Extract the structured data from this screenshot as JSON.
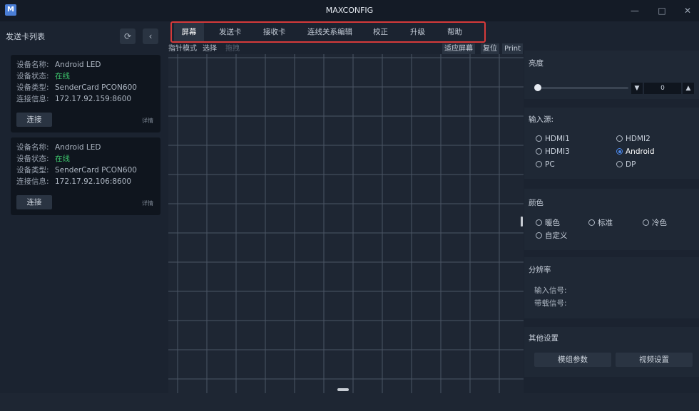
{
  "window": {
    "logo": "M",
    "title": "MAXCONFIG",
    "minimize": "—",
    "maximize": "□",
    "close": "✕"
  },
  "sidebar": {
    "title": "发送卡列表",
    "refresh_icon": "refresh-icon",
    "collapse_icon": "chevron-left-icon",
    "cards": [
      {
        "name_label": "设备名称:",
        "name": "Android LED",
        "status_label": "设备状态:",
        "status": "在线",
        "type_label": "设备类型:",
        "type": "SenderCard PCON600",
        "conn_label": "连接信息:",
        "conn": "172.17.92.159:8600",
        "connect": "连接",
        "detail": "详情"
      },
      {
        "name_label": "设备名称:",
        "name": "Android LED",
        "status_label": "设备状态:",
        "status": "在线",
        "type_label": "设备类型:",
        "type": "SenderCard PCON600",
        "conn_label": "连接信息:",
        "conn": "172.17.92.106:8600",
        "connect": "连接",
        "detail": "详情"
      }
    ]
  },
  "menu": {
    "items": [
      "屏幕",
      "发送卡",
      "接收卡",
      "连线关系编辑",
      "校正",
      "升级",
      "帮助"
    ],
    "active": "屏幕"
  },
  "toolbar": {
    "pointer_mode": "指针模式",
    "select": "选择",
    "drag": "拖拽",
    "fit_screen": "适应屏幕",
    "reset": "复位",
    "print": "Print"
  },
  "right_panel": {
    "brightness": {
      "title": "亮度",
      "value": "0",
      "level": 0
    },
    "input_source": {
      "title": "输入源:",
      "options": [
        "HDMI1",
        "HDMI2",
        "HDMI3",
        "Android",
        "PC",
        "DP"
      ],
      "selected": "Android"
    },
    "color": {
      "title": "颜色",
      "options": [
        "暖色",
        "标准",
        "冷色",
        "自定义"
      ]
    },
    "resolution": {
      "title": "分辨率",
      "input_signal": "输入信号:",
      "carrier_signal": "带载信号:"
    },
    "other": {
      "title": "其他设置",
      "module_params": "模组参数",
      "video_settings": "视频设置"
    }
  },
  "colors": {
    "accent": "#4a86e8",
    "online": "#3cc26b",
    "highlight_border": "#d63a3a",
    "background": "#1b2330"
  }
}
